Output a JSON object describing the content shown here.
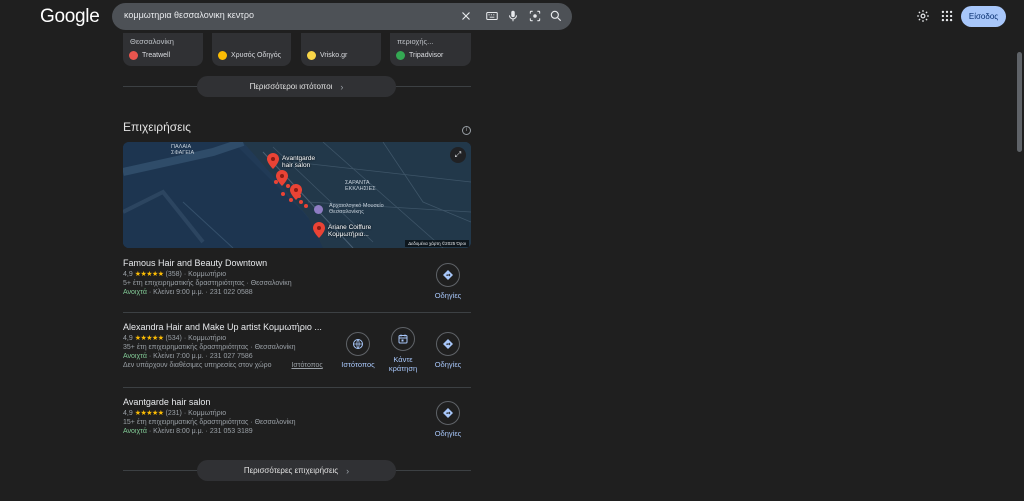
{
  "header": {
    "logo": "Google",
    "query": "κομμωτηρια θεσσαλονικη κεντρο",
    "signin_label": "Είσοδος"
  },
  "sources": [
    {
      "title": "Θεσσαλονίκη",
      "source": "Treatwell",
      "color": "#e8554e"
    },
    {
      "title": "",
      "source": "Χρυσός Οδηγός",
      "color": "#fbbc04"
    },
    {
      "title": "",
      "source": "Vrisko.gr",
      "color": "#f9d648"
    },
    {
      "title": "περιοχής...",
      "source": "Tripadvisor",
      "color": "#34a853"
    }
  ],
  "more_sites_label": "Περισσότεροι ιστότοποι",
  "businesses_section": {
    "title": "Επιχειρήσεις",
    "more_label": "Περισσότερες επιχειρήσεις"
  },
  "map": {
    "labels": {
      "palaia_sfagia": "ΠΑΛΑΙΑ\nΣΦΑΓΕΙΑ",
      "saranta": "ΣΑΡΑΝΤΑ\nΕΚΚΛΗΣΙΕΣ",
      "museum": "Αρχαιολογικό Μουσείο\nΘεσσαλονίκης",
      "avantgarde": "Avantgarde\nhair salon",
      "ariane": "Ariane Coiffure\nΚομμωτήρια..."
    },
    "attribution": "Δεδομένα χάρτη ©2025  Όροι"
  },
  "businesses": [
    {
      "name": "Famous Hair and Beauty Downtown",
      "rating": "4,9",
      "stars": "★★★★★",
      "reviews": "(358)",
      "category": "Κομμωτήριο",
      "years": "5+ έτη επιχειρηματικής δραστηριότητας · Θεσσαλονίκη",
      "status": "Ανοιχτά",
      "hours_phone": "· Κλείνει 9:00 μ.μ. · 231 022 0588",
      "directions_label": "Οδηγίες"
    },
    {
      "name": "Alexandra Hair and Make Up artist Κομμωτήριο ...",
      "rating": "4,9",
      "stars": "★★★★★",
      "reviews": "(534)",
      "category": "Κομμωτήριο",
      "years": "35+ έτη επιχειρηματικής δραστηριότητας · Θεσσαλονίκη",
      "status": "Ανοιχτά",
      "hours_phone": "· Κλείνει 7:00 μ.μ. · 231 027 7586",
      "services": "Δεν υπάρχουν διαθέσιμες υπηρεσίες στον χώρο",
      "website_link": "Ιστότοπος",
      "website_label": "Ιστότοπος",
      "book_label": "Κάντε κράτηση",
      "directions_label": "Οδηγίες"
    },
    {
      "name": "Avantgarde hair salon",
      "rating": "4,9",
      "stars": "★★★★★",
      "reviews": "(231)",
      "category": "Κομμωτήριο",
      "years": "15+ έτη επιχειρηματικής δραστηριότητας · Θεσσαλονίκη",
      "status": "Ανοιχτά",
      "hours_phone": "· Κλείνει 8:00 μ.μ. · 231 053 3189",
      "directions_label": "Οδηγίες"
    }
  ]
}
